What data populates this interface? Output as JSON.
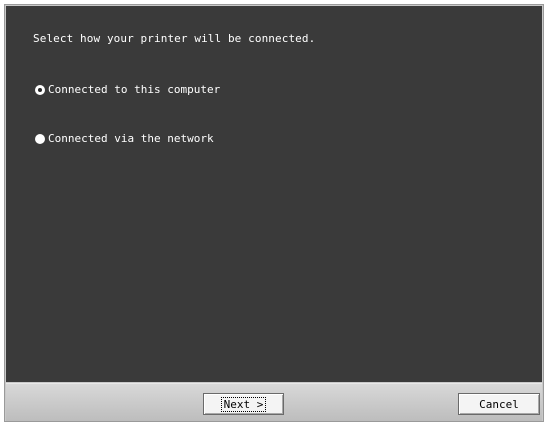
{
  "dialog": {
    "prompt": "Select how your printer will be connected.",
    "options": [
      {
        "label": "Connected to this computer",
        "selected": true
      },
      {
        "label": "Connected via the network",
        "selected": false
      }
    ]
  },
  "buttons": {
    "next_label": "Next >",
    "cancel_label": "Cancel"
  }
}
